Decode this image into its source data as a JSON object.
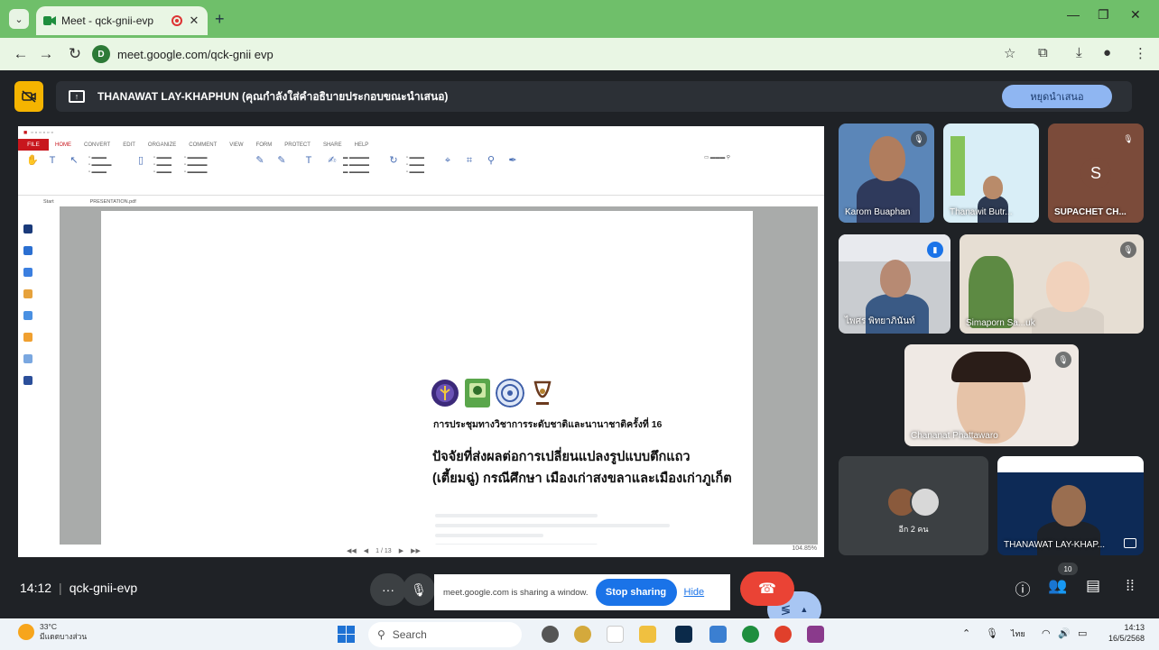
{
  "browser": {
    "tab_title": "Meet - qck-gnii-evp",
    "url": "meet.google.com/qck-gnii evp"
  },
  "meet": {
    "presenter_banner": "THANAWAT LAY-KHAPHUN (คุณกำลังใส่คำอธิบายประกอบขณะนำเสนอ)",
    "stop_presenting_label": "หยุดนำเสนอ",
    "time": "14:12",
    "separator": "|",
    "meeting_code": "qck-gnii-evp",
    "sharing_notice": "meet.google.com is sharing a window.",
    "stop_sharing_label": "Stop sharing",
    "hide_label": "Hide",
    "people_count": "10",
    "participants": [
      {
        "name": "Karom Buaphan"
      },
      {
        "name": "Thanawit Butr..."
      },
      {
        "name": "SUPACHET CH...",
        "initial": "S"
      },
      {
        "name": "ไพศร พิทยาภินันท์"
      },
      {
        "name": "Simaporn Sa...uk"
      },
      {
        "name": "Chananat Phattawaro"
      },
      {
        "name": "THANAWAT LAY-KHAP..."
      }
    ],
    "more_label": "อีก 2 คน"
  },
  "shared_doc": {
    "ribbon_tabs": [
      "FILE",
      "HOME",
      "CONVERT",
      "EDIT",
      "ORGANIZE",
      "COMMENT",
      "VIEW",
      "FORM",
      "PROTECT",
      "SHARE",
      "HELP"
    ],
    "doc_tabs": [
      "Start",
      "PRESENTATION.pdf"
    ],
    "conference_name": "การประชุมทางวิชาการระดับชาติและนานาชาติครั้งที่ 16",
    "paper_title_line1": "ปัจจัยที่ส่งผลต่อการเปลี่ยนแปลงรูปแบบตึกแถว",
    "paper_title_line2": "(เตี้ยมฉู่) กรณีศึกษา เมืองเก่าสงขลาและเมืองเก่าภูเก็ต",
    "page_nav": "1 / 13",
    "zoom": "104.85%"
  },
  "taskbar": {
    "temperature": "33°C",
    "weather_desc": "มีแดดบางส่วน",
    "search_placeholder": "Search",
    "lang": "ไทย",
    "time": "14:13",
    "date": "16/5/2568"
  }
}
